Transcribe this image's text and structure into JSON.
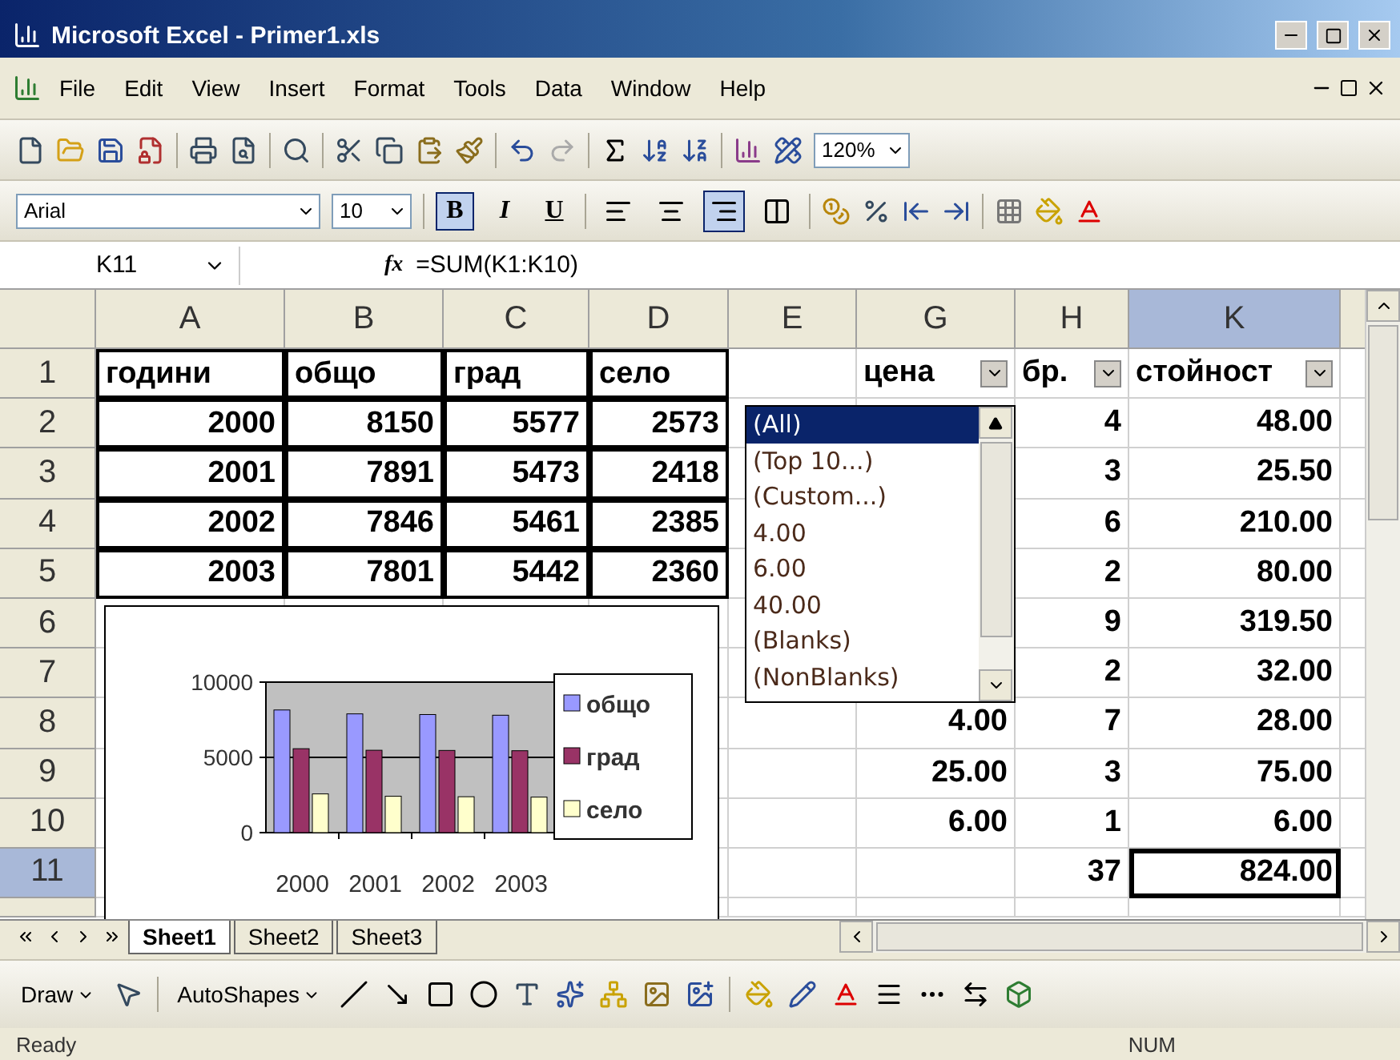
{
  "window": {
    "title": "Microsoft Excel - Primer1.xls"
  },
  "menu": [
    "File",
    "Edit",
    "View",
    "Insert",
    "Format",
    "Tools",
    "Data",
    "Window",
    "Help"
  ],
  "standard_toolbar": {
    "zoom": "120%"
  },
  "formatting_toolbar": {
    "font": "Arial",
    "size": "10",
    "styles": [
      {
        "label": "B",
        "selected": true
      },
      {
        "label": "I",
        "selected": false
      },
      {
        "label": "U",
        "selected": false
      }
    ],
    "alignment": [
      {
        "kind": "left",
        "selected": false
      },
      {
        "kind": "center",
        "selected": false
      },
      {
        "kind": "right",
        "selected": true
      },
      {
        "kind": "merge",
        "selected": false
      }
    ]
  },
  "formula_bar": {
    "name_box": "K11",
    "fx": "fx",
    "formula": "=SUM(K1:K10)"
  },
  "columns": [
    {
      "label": "A",
      "selected": false
    },
    {
      "label": "B",
      "selected": false
    },
    {
      "label": "C",
      "selected": false
    },
    {
      "label": "D",
      "selected": false
    },
    {
      "label": "E",
      "selected": false
    },
    {
      "label": "G",
      "selected": false
    },
    {
      "label": "H",
      "selected": false
    },
    {
      "label": "K",
      "selected": true
    }
  ],
  "rows": [
    {
      "number": "1",
      "selected": false,
      "cells": [
        {
          "text": "години",
          "border": true
        },
        {
          "text": "общо",
          "border": true
        },
        {
          "text": "град",
          "border": true
        },
        {
          "text": "село",
          "border": true
        },
        {},
        {
          "text": "цена",
          "filter": true
        },
        {
          "text": "бр.",
          "filter": true
        },
        {
          "text": "стойност",
          "filter": true
        }
      ]
    },
    {
      "number": "2",
      "selected": false,
      "cells": [
        {
          "text": "2000",
          "border": true
        },
        {
          "text": "8150",
          "border": true
        },
        {
          "text": "5577",
          "border": true
        },
        {
          "text": "2573",
          "border": true
        },
        {},
        {},
        {
          "text": "4"
        },
        {
          "text": "48.00"
        }
      ]
    },
    {
      "number": "3",
      "selected": false,
      "cells": [
        {
          "text": "2001",
          "border": true
        },
        {
          "text": "7891",
          "border": true
        },
        {
          "text": "5473",
          "border": true
        },
        {
          "text": "2418",
          "border": true
        },
        {},
        {},
        {
          "text": "3"
        },
        {
          "text": "25.50"
        }
      ]
    },
    {
      "number": "4",
      "selected": false,
      "cells": [
        {
          "text": "2002",
          "border": true
        },
        {
          "text": "7846",
          "border": true
        },
        {
          "text": "5461",
          "border": true
        },
        {
          "text": "2385",
          "border": true
        },
        {},
        {},
        {
          "text": "6"
        },
        {
          "text": "210.00"
        }
      ]
    },
    {
      "number": "5",
      "selected": false,
      "cells": [
        {
          "text": "2003",
          "border": true
        },
        {
          "text": "7801",
          "border": true
        },
        {
          "text": "5442",
          "border": true
        },
        {
          "text": "2360",
          "border": true
        },
        {},
        {},
        {
          "text": "2"
        },
        {
          "text": "80.00"
        }
      ]
    },
    {
      "number": "6",
      "selected": false,
      "cells": [
        {},
        {},
        {},
        {},
        {},
        {},
        {
          "text": "9"
        },
        {
          "text": "319.50"
        }
      ]
    },
    {
      "number": "7",
      "selected": false,
      "cells": [
        {},
        {},
        {},
        {},
        {},
        {},
        {
          "text": "2"
        },
        {
          "text": "32.00"
        }
      ]
    },
    {
      "number": "8",
      "selected": false,
      "cells": [
        {},
        {},
        {},
        {},
        {},
        {
          "text": "4.00"
        },
        {
          "text": "7"
        },
        {
          "text": "28.00"
        }
      ]
    },
    {
      "number": "9",
      "selected": false,
      "cells": [
        {},
        {},
        {},
        {},
        {},
        {
          "text": "25.00"
        },
        {
          "text": "3"
        },
        {
          "text": "75.00"
        }
      ]
    },
    {
      "number": "10",
      "selected": false,
      "cells": [
        {},
        {},
        {},
        {},
        {},
        {
          "text": "6.00"
        },
        {
          "text": "1"
        },
        {
          "text": "6.00"
        }
      ]
    },
    {
      "number": "11",
      "selected": true,
      "cells": [
        {},
        {},
        {},
        {},
        {},
        {},
        {
          "text": "37"
        },
        {
          "text": "824.00"
        }
      ]
    }
  ],
  "chart": {
    "chart_data": {
      "type": "bar",
      "categories": [
        "2000",
        "2001",
        "2002",
        "2003"
      ],
      "series": [
        {
          "name": "общо",
          "color": "#9999ff",
          "values": [
            8150,
            7891,
            7846,
            7801
          ]
        },
        {
          "name": "град",
          "color": "#993366",
          "values": [
            5577,
            5473,
            5461,
            5442
          ]
        },
        {
          "name": "село",
          "color": "#ffffcc",
          "values": [
            2573,
            2418,
            2385,
            2360
          ]
        }
      ],
      "ylim": [
        0,
        10000
      ],
      "yticks": [
        0,
        5000,
        10000
      ],
      "legend": true
    }
  },
  "filter_dropdown": {
    "items": [
      {
        "label": "(All)",
        "selected": true
      },
      {
        "label": "(Top 10...)",
        "selected": false
      },
      {
        "label": "(Custom...)",
        "selected": false
      },
      {
        "label": "4.00",
        "selected": false
      },
      {
        "label": "6.00",
        "selected": false
      },
      {
        "label": "40.00",
        "selected": false
      },
      {
        "label": "(Blanks)",
        "selected": false
      },
      {
        "label": "(NonBlanks)",
        "selected": false
      }
    ]
  },
  "sheet_tabs": [
    {
      "label": "Sheet1",
      "selected": true
    },
    {
      "label": "Sheet2",
      "selected": false
    },
    {
      "label": "Sheet3",
      "selected": false
    }
  ],
  "drawing_toolbar": {
    "draw": "Draw",
    "autoshapes": "AutoShapes"
  },
  "status_bar": {
    "status": "Ready",
    "num": "NUM"
  }
}
